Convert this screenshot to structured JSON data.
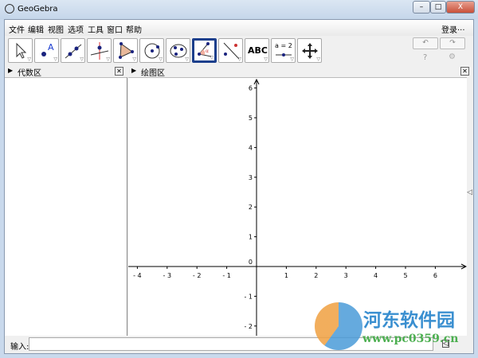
{
  "window": {
    "title": "GeoGebra",
    "min": "–",
    "max": "□",
    "close": "X"
  },
  "menu": [
    "文件",
    "编辑",
    "视图",
    "选项",
    "工具",
    "窗口",
    "帮助"
  ],
  "login": "登录···",
  "tools": [
    "move",
    "point",
    "line",
    "perpendicular",
    "polygon",
    "circle",
    "conic",
    "angle",
    "reflect",
    "text",
    "slider",
    "move-graphics-view"
  ],
  "tool_labels": {
    "text": "ABC",
    "slider": "a = 2"
  },
  "selected_tool": "angle",
  "undo": "↶",
  "redo": "↷",
  "help": "?",
  "settings": "⚙",
  "algebra_title": "代数区",
  "graphics_title": "绘图区",
  "input_label": "输入:",
  "input_value": "",
  "axes": {
    "x_ticks": [
      -4,
      -3,
      -2,
      -1,
      1,
      2,
      3,
      4,
      5,
      6
    ],
    "y_ticks": [
      6,
      5,
      4,
      3,
      2,
      1,
      -1,
      -2
    ],
    "origin": "0"
  },
  "watermark": {
    "name": "河东软件园",
    "url": "www.pc0359.cn"
  }
}
